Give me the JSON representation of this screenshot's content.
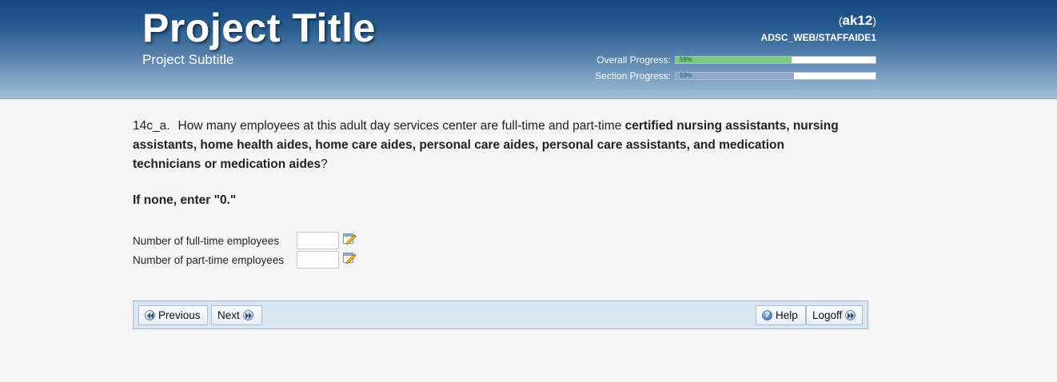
{
  "header": {
    "title": "Project Title",
    "subtitle": "Project Subtitle",
    "user_open": "(",
    "user_id": "ak12",
    "user_close": ")",
    "path": "ADSC_WEB/STAFFAIDE1",
    "overall_label": "Overall Progress:",
    "overall_text": "58%",
    "overall_value": 0.58,
    "section_label": "Section Progress:",
    "section_text": "59%",
    "section_value": 0.59
  },
  "question": {
    "number": "14c_a.",
    "text_before": "How many employees at this adult day services center are full-time and part-time ",
    "text_bold": "certified nursing assistants, nursing assistants, home health aides, home care aides, personal care aides, personal care assistants, and medication technicians or medication aides",
    "text_after": "?"
  },
  "instruction": "If none, enter \"0.\"",
  "fields": [
    {
      "label": "Number of full-time employees",
      "value": "",
      "icon": "note-edit-icon"
    },
    {
      "label": "Number of part-time employees",
      "value": "",
      "icon": "note-edit-icon"
    }
  ],
  "nav": {
    "previous_label": "Previous",
    "next_label": "Next",
    "help_label": "Help",
    "logoff_label": "Logoff"
  },
  "colors": {
    "header_top": "#14477e",
    "header_bottom": "#a2bfd8",
    "overall_fill": "#7ccb83",
    "section_fill": "#8eaac7",
    "navbar_bg": "#dbe6f3"
  }
}
